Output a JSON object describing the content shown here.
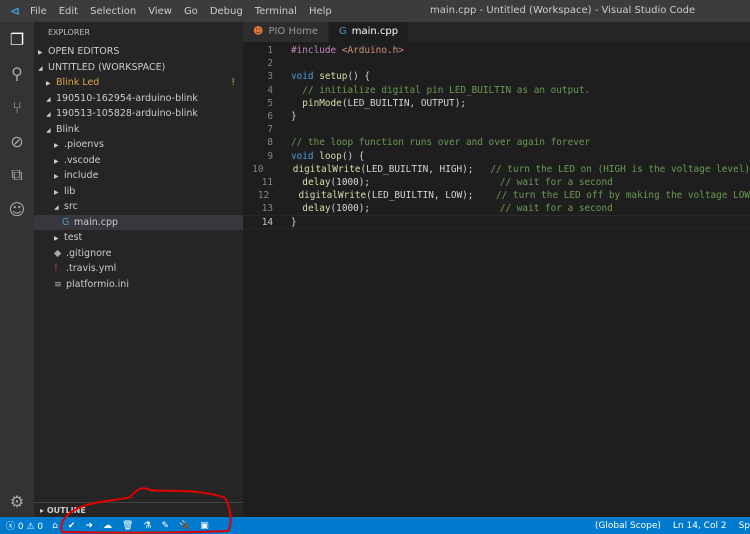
{
  "window": {
    "title": "main.cpp - Untitled (Workspace) - Visual Studio Code",
    "menu": [
      "File",
      "Edit",
      "Selection",
      "View",
      "Go",
      "Debug",
      "Terminal",
      "Help"
    ]
  },
  "activity": [
    "files-icon",
    "search-icon",
    "source-control-icon",
    "debug-icon",
    "extensions-icon",
    "platformio-icon"
  ],
  "sidebar": {
    "header": "EXPLORER",
    "outline": "OUTLINE",
    "rows": [
      {
        "label": "OPEN EDITORS",
        "depth": 0,
        "twisty": "closed",
        "kind": "section"
      },
      {
        "label": "UNTITLED (WORKSPACE)",
        "depth": 0,
        "twisty": "open",
        "kind": "section"
      },
      {
        "label": "Blink Led",
        "depth": 1,
        "twisty": "closed",
        "kind": "warn",
        "badge": "!"
      },
      {
        "label": "190510-162954-arduino-blink",
        "depth": 1,
        "twisty": "open"
      },
      {
        "label": "190513-105828-arduino-blink",
        "depth": 1,
        "twisty": "open"
      },
      {
        "label": "Blink",
        "depth": 1,
        "twisty": "open"
      },
      {
        "label": ".pioenvs",
        "depth": 2,
        "twisty": "closed"
      },
      {
        "label": ".vscode",
        "depth": 2,
        "twisty": "closed"
      },
      {
        "label": "include",
        "depth": 2,
        "twisty": "closed"
      },
      {
        "label": "lib",
        "depth": 2,
        "twisty": "closed"
      },
      {
        "label": "src",
        "depth": 2,
        "twisty": "open"
      },
      {
        "label": "main.cpp",
        "depth": 3,
        "icon": "G",
        "kind": "sel"
      },
      {
        "label": "test",
        "depth": 2,
        "twisty": "closed"
      },
      {
        "label": ".gitignore",
        "depth": 2,
        "icon": "◆"
      },
      {
        "label": ".travis.yml",
        "depth": 2,
        "icon": "!"
      },
      {
        "label": "platformio.ini",
        "depth": 2,
        "icon": "≡"
      }
    ]
  },
  "tabs": [
    {
      "label": "PIO Home",
      "icon": "☻",
      "active": false
    },
    {
      "label": "main.cpp",
      "icon": "G",
      "active": true
    }
  ],
  "editor": {
    "current_line": 14,
    "lines": [
      [
        [
          "pp",
          "#include "
        ],
        [
          "st",
          "<Arduino.h>"
        ]
      ],
      [],
      [
        [
          "kw",
          "void "
        ],
        [
          "fn",
          "setup"
        ],
        [
          "tx",
          "() {"
        ]
      ],
      [
        [
          "tx",
          "  "
        ],
        [
          "cm",
          "// initialize digital pin LED_BUILTIN as an output."
        ]
      ],
      [
        [
          "tx",
          "  "
        ],
        [
          "fn",
          "pinMode"
        ],
        [
          "tx",
          "(LED_BUILTIN, OUTPUT);"
        ]
      ],
      [
        [
          "tx",
          "}"
        ]
      ],
      [],
      [
        [
          "cm",
          "// the loop function runs over and over again forever"
        ]
      ],
      [
        [
          "kw",
          "void "
        ],
        [
          "fn",
          "loop"
        ],
        [
          "tx",
          "() {"
        ]
      ],
      [
        [
          "tx",
          "  "
        ],
        [
          "fn",
          "digitalWrite"
        ],
        [
          "tx",
          "(LED_BUILTIN, HIGH);   "
        ],
        [
          "cm",
          "// turn the LED on (HIGH is the voltage level)"
        ]
      ],
      [
        [
          "tx",
          "  "
        ],
        [
          "fn",
          "delay"
        ],
        [
          "tx",
          "(1000);                       "
        ],
        [
          "cm",
          "// wait for a second"
        ]
      ],
      [
        [
          "tx",
          "  "
        ],
        [
          "fn",
          "digitalWrite"
        ],
        [
          "tx",
          "(LED_BUILTIN, LOW);    "
        ],
        [
          "cm",
          "// turn the LED off by making the voltage LOW"
        ]
      ],
      [
        [
          "tx",
          "  "
        ],
        [
          "fn",
          "delay"
        ],
        [
          "tx",
          "(1000);                       "
        ],
        [
          "cm",
          "// wait for a second"
        ]
      ],
      [
        [
          "tx",
          "}"
        ]
      ]
    ]
  },
  "status": {
    "errors": "0",
    "warnings": "0",
    "pio_buttons": [
      {
        "name": "home",
        "glyph": "⌂"
      },
      {
        "name": "build",
        "glyph": "✔"
      },
      {
        "name": "upload",
        "glyph": "➜"
      },
      {
        "name": "upload-remote",
        "glyph": "☁"
      },
      {
        "name": "clean",
        "glyph": "🗑"
      },
      {
        "name": "test",
        "glyph": "⚗"
      },
      {
        "name": "run-task",
        "glyph": "✎"
      },
      {
        "name": "serial-monitor",
        "glyph": "🔌"
      },
      {
        "name": "terminal",
        "glyph": "▣"
      }
    ],
    "scope": "(Global Scope)",
    "position": "Ln 14, Col 2",
    "spaces": "Sp"
  },
  "colors": {
    "statusbar": "#007acc",
    "annotation": "#e00000"
  }
}
